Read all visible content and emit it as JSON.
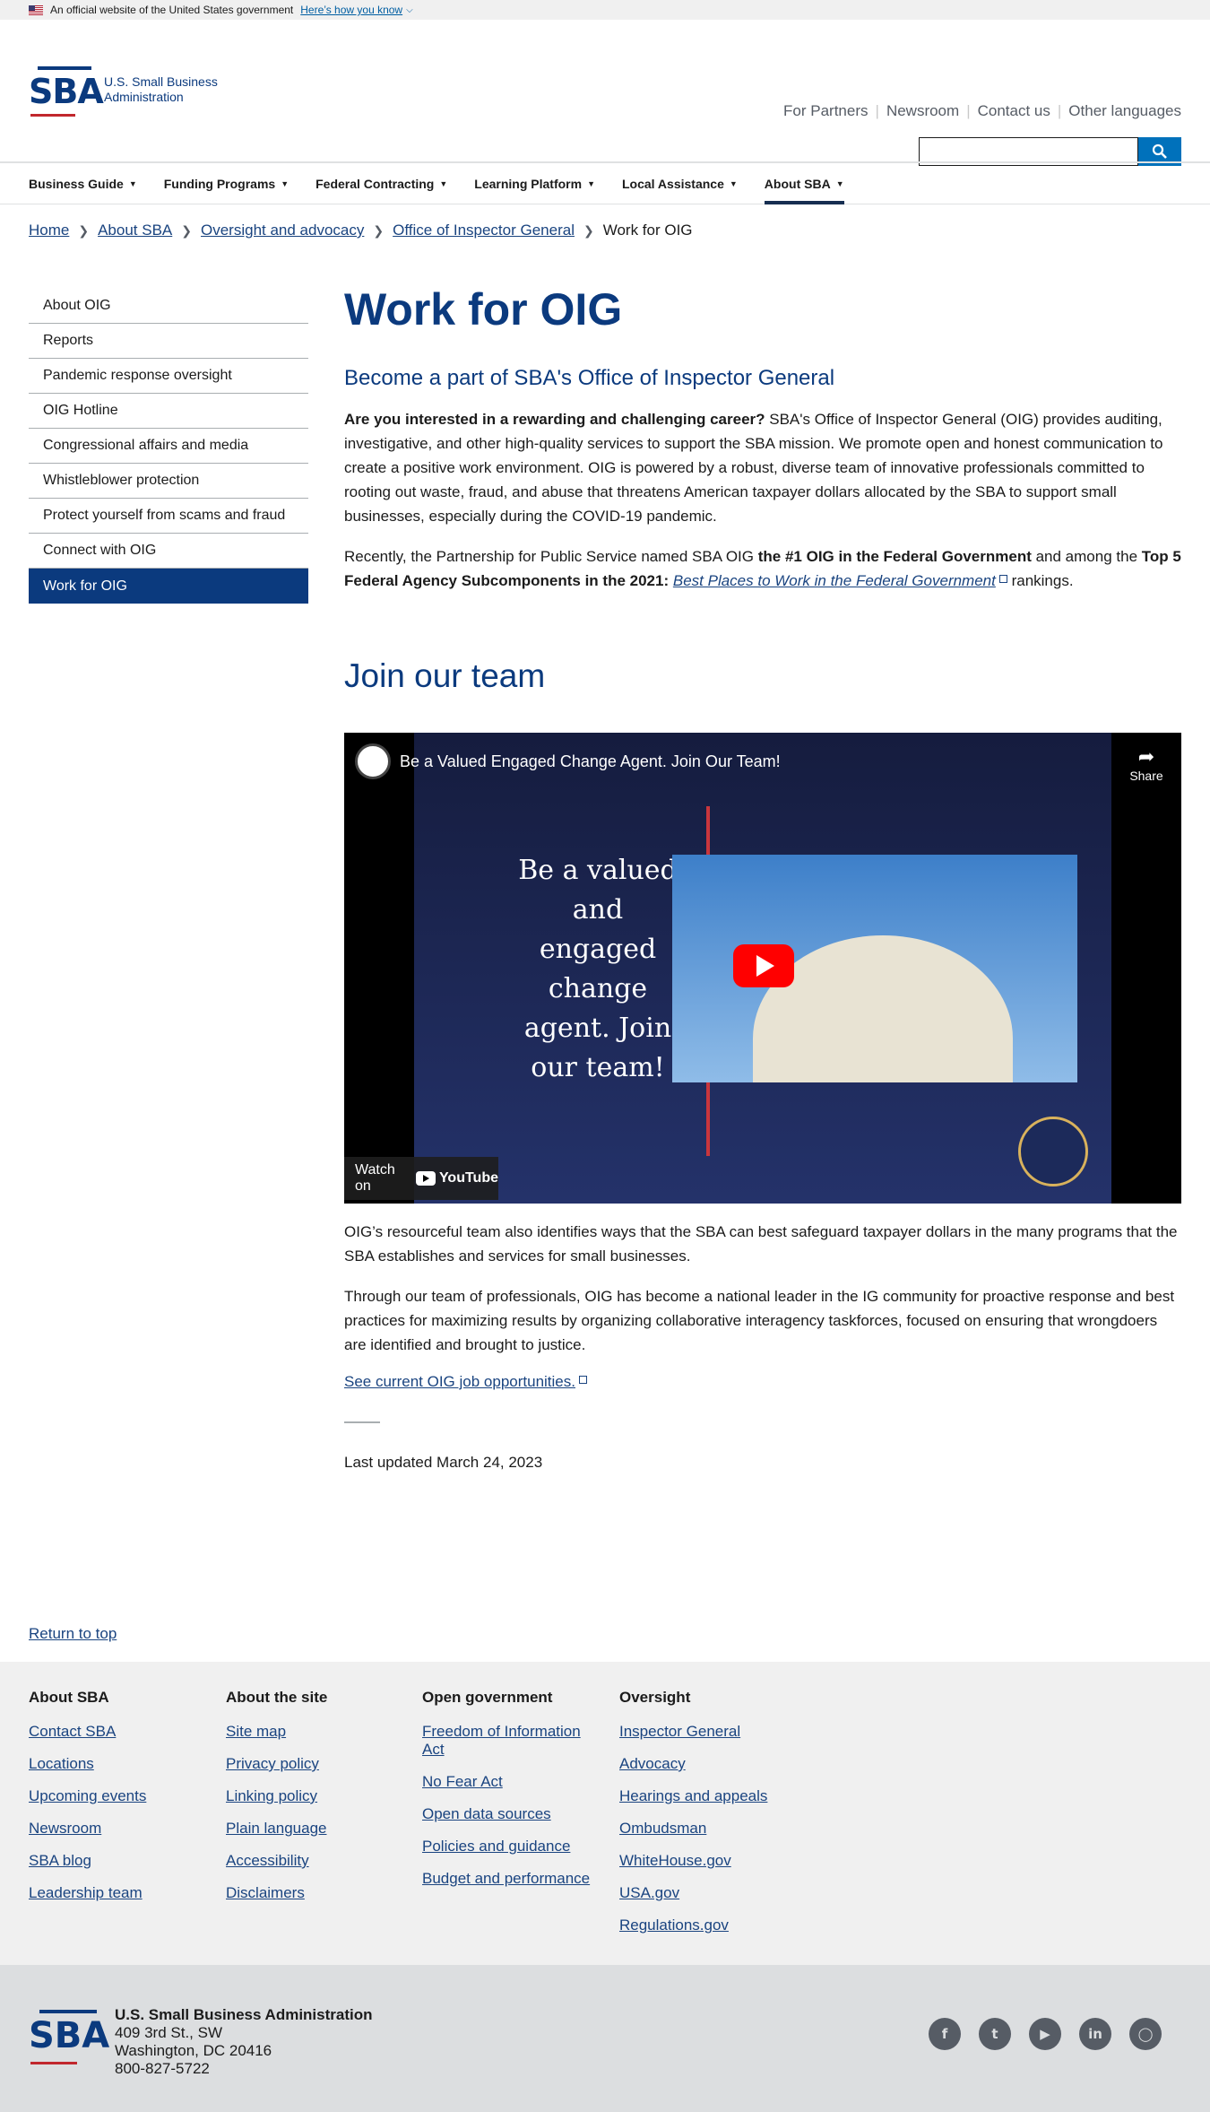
{
  "gov_banner": {
    "text": "An official website of the United States government",
    "link": "Here’s how you know"
  },
  "header": {
    "logo_line1": "U.S. Small Business",
    "logo_line2": "Administration",
    "logo_letters": "SBA",
    "util_links": [
      "For Partners",
      "Newsroom",
      "Contact us",
      "Other languages"
    ]
  },
  "nav": {
    "items": [
      "Business Guide",
      "Funding Programs",
      "Federal Contracting",
      "Learning Platform",
      "Local Assistance",
      "About SBA"
    ],
    "active": "About SBA"
  },
  "breadcrumb": {
    "items": [
      "Home",
      "About SBA",
      "Oversight and advocacy",
      "Office of Inspector General"
    ],
    "current": "Work for OIG"
  },
  "sidenav": {
    "items": [
      "About OIG",
      "Reports",
      "Pandemic response oversight",
      "OIG Hotline",
      "Congressional affairs and media",
      "Whistleblower protection",
      "Protect yourself from scams and fraud",
      "Connect with OIG",
      "Work for OIG"
    ]
  },
  "main": {
    "title": "Work for OIG",
    "subtitle": "Become a part of SBA's Office of Inspector General",
    "p1_bold": "Are you interested in a rewarding and challenging career?",
    "p1_rest": " SBA's Office of Inspector General (OIG) provides auditing, investigative, and other high-quality services to support the SBA mission. We promote open and honest communication to create a positive work environment. OIG is powered by a robust, diverse team of innovative professionals committed to rooting out waste, fraud, and abuse that threatens American taxpayer dollars allocated by the SBA to support small businesses, especially during the COVID-19 pandemic.",
    "p2_a": "Recently, the Partnership for Public Service named SBA OIG ",
    "p2_b": "the #1 OIG in the Federal Government",
    "p2_c": " and among the ",
    "p2_d": "Top 5 Federal Agency Subcomponents in the 2021:",
    "p2_link": "Best Places to Work in the Federal Government",
    "p2_e": " rankings.",
    "join_heading": "Join our team",
    "video_title": "Be a Valued Engaged Change Agent. Join Our Team!",
    "video_share": "Share",
    "video_bigtext": "Be a valued and engaged change agent. Join our team!",
    "video_watch": "Watch on",
    "video_brand": "YouTube",
    "p3": "OIG’s resourceful team also identifies ways that the SBA can best safeguard taxpayer dollars in the many programs that the SBA establishes and services for small businesses.",
    "p4": "Through our team of professionals, OIG has become a national leader in the IG community for proactive response and best practices for maximizing results by organizing collaborative interagency taskforces, focused on ensuring that wrongdoers are identified and brought to justice.",
    "job_link": "See current OIG job opportunities.",
    "updated": "Last updated March 24, 2023"
  },
  "return_top": "Return to top",
  "footer": {
    "cols": [
      {
        "heading": "About SBA",
        "links": [
          "Contact SBA",
          "Locations",
          "Upcoming events",
          "Newsroom",
          "SBA blog",
          "Leadership team"
        ]
      },
      {
        "heading": "About the site",
        "links": [
          "Site map",
          "Privacy policy",
          "Linking policy",
          "Plain language",
          "Accessibility",
          "Disclaimers"
        ]
      },
      {
        "heading": "Open government",
        "links": [
          "Freedom of Information Act",
          "No Fear Act",
          "Open data sources",
          "Policies and guidance",
          "Budget and performance"
        ]
      },
      {
        "heading": "Oversight",
        "links": [
          "Inspector General",
          "Advocacy",
          "Hearings and appeals",
          "Ombudsman",
          "WhiteHouse.gov",
          "USA.gov",
          "Regulations.gov"
        ]
      }
    ],
    "org_name": "U.S. Small Business Administration",
    "addr1": "409 3rd St., SW",
    "addr2": "Washington, DC 20416",
    "phone": "800-827-5722",
    "social": [
      "facebook-icon",
      "twitter-icon",
      "youtube-icon",
      "linkedin-icon",
      "instagram-icon"
    ]
  },
  "colors": {
    "brand_navy": "#0b3a7e",
    "link": "#1a4480",
    "search_button": "#0071bb",
    "accent_red": "#c1272d"
  }
}
